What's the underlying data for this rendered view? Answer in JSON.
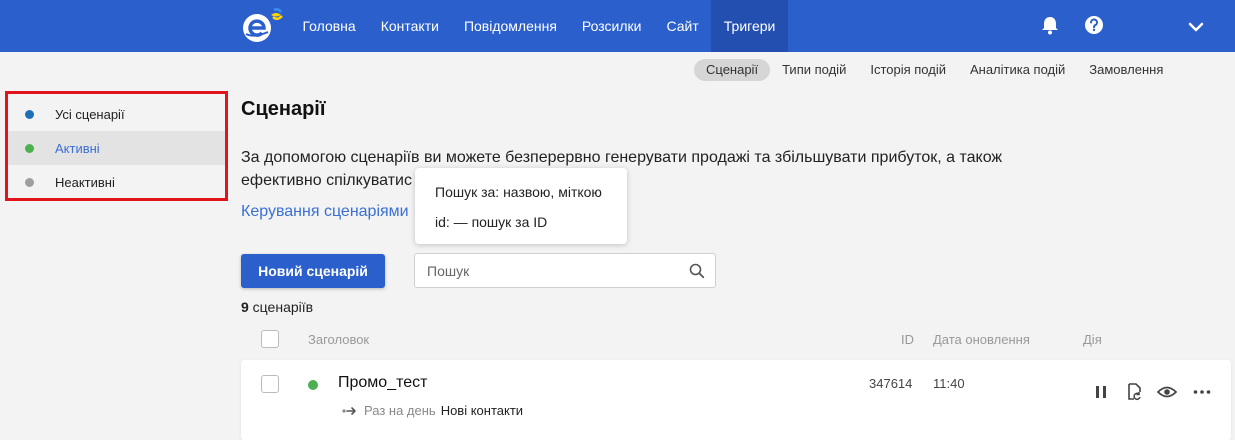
{
  "topbar": {
    "nav": [
      "Головна",
      "Контакти",
      "Повідомлення",
      "Розсилки",
      "Сайт",
      "Тригери"
    ],
    "active_nav": "Тригери",
    "colors": {
      "bar": "#2b5fcc",
      "active": "#2350b0"
    },
    "icons": [
      "logo-icon",
      "bell-icon",
      "help-icon",
      "chevron-down-icon"
    ]
  },
  "subnav": {
    "items": [
      "Сценарії",
      "Типи подій",
      "Історія подій",
      "Аналітика подій",
      "Замовлення"
    ],
    "active": "Сценарії"
  },
  "sidebar": {
    "items": [
      {
        "label": "Усі сценарії",
        "dot_color": "#1e6fb8"
      },
      {
        "label": "Активні",
        "dot_color": "#4caf50"
      },
      {
        "label": "Неактивні",
        "dot_color": "#9e9e9e"
      }
    ],
    "selected": "Активні",
    "highlight_color": "#e1131b"
  },
  "main": {
    "title": "Сценарії",
    "description_line1": "За допомогою сценаріїв ви можете безперервно генерувати продажі та збільшувати прибуток, а також",
    "description_line2": "ефективно спілкуватис",
    "manage_link": "Керування сценаріями"
  },
  "tooltip": {
    "line1": "Пошук за: назвою, міткою",
    "line2": "id: — пошук за ID"
  },
  "toolbar": {
    "new_button": "Новий сценарій",
    "search_placeholder": "Пошук"
  },
  "summary": {
    "count": "9",
    "count_label": " сценаріїв"
  },
  "table": {
    "headers": {
      "title": "Заголовок",
      "id": "ID",
      "date": "Дата оновлення",
      "action": "Дія"
    },
    "rows": [
      {
        "title": "Промо_тест",
        "status_color": "#4caf50",
        "schedule": "Раз на день",
        "trigger": "Нові контакти",
        "id": "347614",
        "updated": "11:40",
        "actions": [
          "pause-icon",
          "restart-icon",
          "eye-icon",
          "more-icon"
        ]
      }
    ]
  }
}
